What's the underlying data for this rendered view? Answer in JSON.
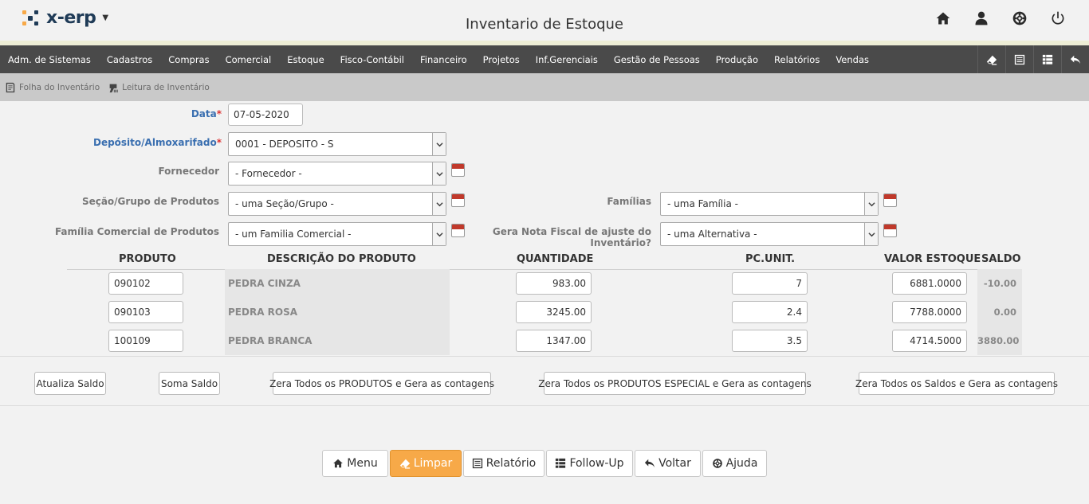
{
  "app": {
    "logo_text": "x-erp",
    "title": "Inventario de Estoque",
    "brand_colors": {
      "navy": "#1f3b57",
      "orange": "#f7a948",
      "menubar": "#4a4a4a"
    },
    "top_icons": [
      "home-icon",
      "user-icon",
      "help-lifebuoy-icon",
      "power-icon"
    ]
  },
  "menu": {
    "items": [
      "Adm. de Sistemas",
      "Cadastros",
      "Compras",
      "Comercial",
      "Estoque",
      "Fisco-Contábil",
      "Financeiro",
      "Projetos",
      "Inf.Gerenciais",
      "Gestão de Pessoas",
      "Produção",
      "Relatórios",
      "Vendas"
    ],
    "tools": [
      "eraser-icon",
      "list-icon",
      "table-icon",
      "back-arrow-icon"
    ]
  },
  "subnav": {
    "items": [
      {
        "label": "Folha do Inventário",
        "icon": "sheet-icon"
      },
      {
        "label": "Leitura de Inventário",
        "icon": "barcode-reader-icon"
      }
    ]
  },
  "form": {
    "data": {
      "label": "Data",
      "value": "07-05-2020"
    },
    "deposito": {
      "label": "Depósito/Almoxarifado",
      "value": "0001 - DEPOSITO - S"
    },
    "fornecedor": {
      "label": "Fornecedor",
      "value": "- Fornecedor -"
    },
    "secao": {
      "label": "Seção/Grupo de Produtos",
      "value": "- uma Seção/Grupo -"
    },
    "familias": {
      "label": "Famílias",
      "value": "- uma Família -"
    },
    "familia_comercial": {
      "label": "Família Comercial de Produtos",
      "value": "- um Familia Comercial -"
    },
    "gera_nota": {
      "label": "Gera Nota Fiscal de ajuste do Inventário?",
      "value": "- uma Alternativa -"
    }
  },
  "table": {
    "headers": {
      "produto": "PRODUTO",
      "descricao": "DESCRIÇÃO DO PRODUTO",
      "quantidade": "QUANTIDADE",
      "pc_unit": "PC.UNIT.",
      "valor": "VALOR ESTOQUE",
      "saldo": "SALDO"
    },
    "rows": [
      {
        "produto": "090102",
        "descricao": "PEDRA CINZA",
        "quantidade": "983.00",
        "pc_unit": "7",
        "valor": "6881.0000",
        "saldo": "-10.00"
      },
      {
        "produto": "090103",
        "descricao": "PEDRA ROSA",
        "quantidade": "3245.00",
        "pc_unit": "2.4",
        "valor": "7788.0000",
        "saldo": "0.00"
      },
      {
        "produto": "100109",
        "descricao": "PEDRA BRANCA",
        "quantidade": "1347.00",
        "pc_unit": "3.5",
        "valor": "4714.5000",
        "saldo": "3880.00"
      }
    ]
  },
  "actions": {
    "atualiza_saldo": "Atualiza Saldo",
    "soma_saldo": "Soma Saldo",
    "zera_produtos": "Zera Todos os PRODUTOS e Gera as contagens",
    "zera_especial": "Zera Todos os PRODUTOS ESPECIAL e Gera as contagens",
    "zera_saldos": "Zera Todos os Saldos e Gera as contagens"
  },
  "footer": {
    "menu": "Menu",
    "limpar": "Limpar",
    "relatorio": "Relatório",
    "followup": "Follow-Up",
    "voltar": "Voltar",
    "ajuda": "Ajuda"
  }
}
